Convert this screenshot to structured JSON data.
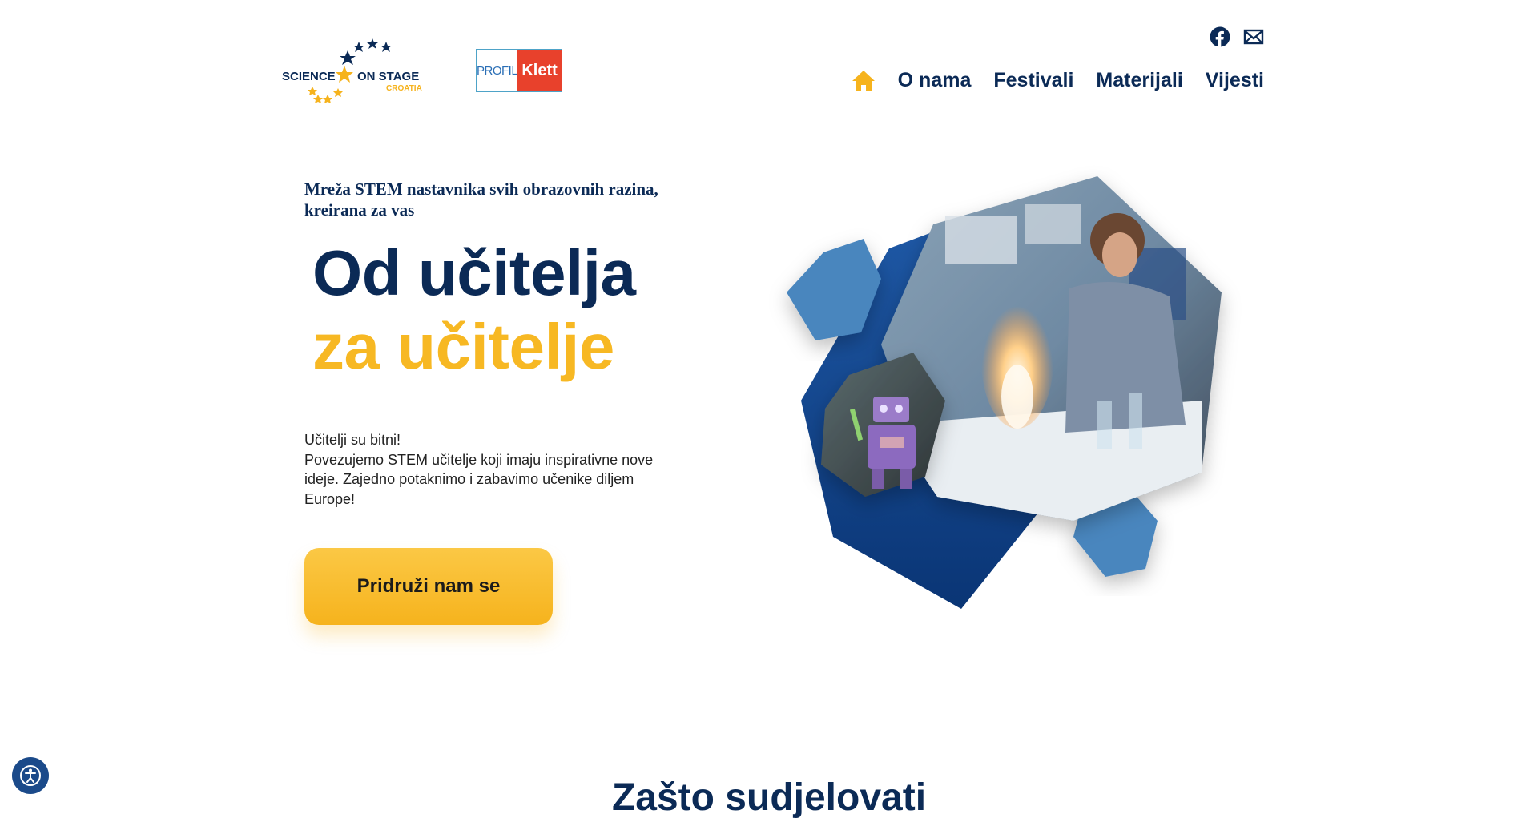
{
  "header": {
    "logo_sos": {
      "line1_left": "SCIENCE",
      "line1_right": "ON STAGE",
      "line2": "CROATIA"
    },
    "logo_klett": {
      "left": "PROFIL",
      "right": "Klett"
    },
    "social": {
      "facebook_icon": "facebook-icon",
      "mail_icon": "mail-icon"
    },
    "nav": {
      "home_icon": "home-icon",
      "items": [
        "O nama",
        "Festivali",
        "Materijali",
        "Vijesti"
      ]
    }
  },
  "hero": {
    "tagline": "Mreža STEM nastavnika svih obrazovnih razina, kreirana za vas",
    "headline_line1": "Od učitelja",
    "headline_line2": "za učitelje",
    "intro_line1": "Učitelji su bitni!",
    "intro_line2": "Povezujemo STEM učitelje koji imaju inspirativne nove ideje. Zajedno potaknimo i zabavimo učenike diljem Europe!",
    "cta_label": "Pridruži nam se"
  },
  "section": {
    "title": "Zašto sudjelovati"
  },
  "colors": {
    "navy": "#0b2a56",
    "accent_yellow": "#f7b823",
    "hex_blue": "#4a86be",
    "hex_dark": "#0d3f82"
  }
}
